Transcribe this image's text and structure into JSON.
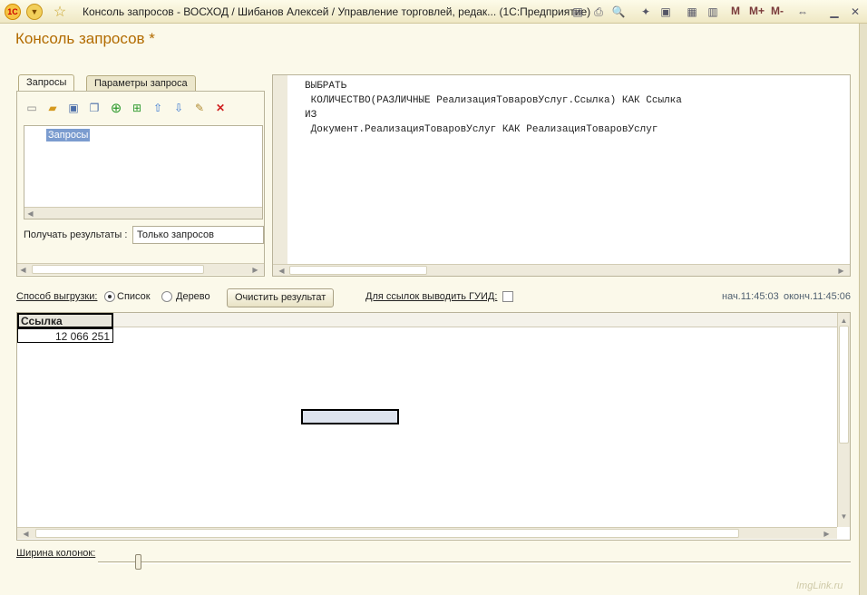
{
  "window": {
    "title": "Консоль запросов - ВОСХОД / Шибанов Алексей /  Управление торговлей, редак...  (1С:Предприятие)",
    "logo_text": "1С",
    "memory_buttons": [
      "M",
      "M+",
      "M-"
    ]
  },
  "form": {
    "title": "Консоль запросов *"
  },
  "tabs": [
    {
      "label": "Запросы"
    },
    {
      "label": "Параметры запроса"
    }
  ],
  "toolbar": {
    "icons": [
      "new-icon",
      "open-folder-icon",
      "save-icon",
      "copy-icon",
      "add-icon",
      "add-child-icon",
      "move-up-icon",
      "move-down-icon",
      "edit-icon",
      "delete-icon"
    ]
  },
  "tree": {
    "root_item": "Запросы"
  },
  "get_results": {
    "label": "Получать результаты :",
    "value": "Только запросов"
  },
  "query_text": "ВЫБРАТЬ\n КОЛИЧЕСТВО(РАЗЛИЧНЫЕ РеализацияТоваровУслуг.Ссылка) КАК Ссылка\nИЗ\n Документ.РеализацияТоваровУслуг КАК РеализацияТоваровУслуг",
  "export": {
    "label": "Способ выгрузки:",
    "option_list": "Список",
    "option_tree": "Дерево",
    "selected": "Список",
    "clear_button": "Очистить результат",
    "guid_label": "Для ссылок выводить ГУИД:",
    "guid_checked": false
  },
  "timing": {
    "start": "нач.11:45:03",
    "end": "оконч.11:45:06"
  },
  "results": {
    "columns": [
      "Ссылка"
    ],
    "rows": [
      [
        "12 066 251"
      ]
    ]
  },
  "column_width": {
    "label": "Ширина колонок:"
  },
  "watermark": "ImgLink.ru"
}
